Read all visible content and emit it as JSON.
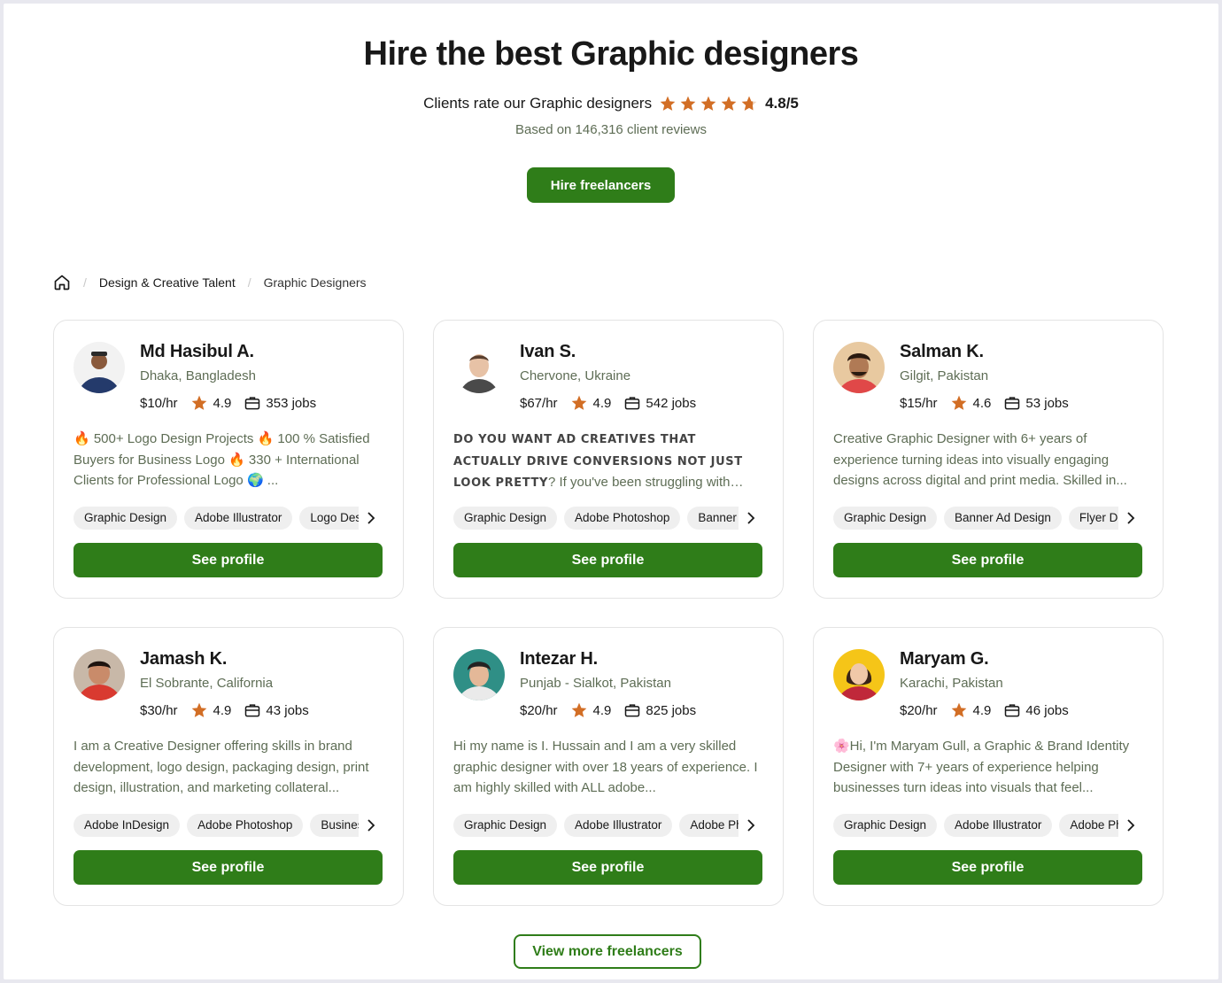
{
  "hero": {
    "title": "Hire the best Graphic designers",
    "rating_text": "Clients rate our Graphic designers",
    "rating_score": "4.8/5",
    "reviews": "Based on 146,316 client reviews",
    "hire_button": "Hire freelancers"
  },
  "breadcrumb": {
    "home_icon": "home-icon",
    "link": "Design & Creative Talent",
    "current": "Graphic Designers"
  },
  "colors": {
    "accent": "#2f7d19",
    "star": "#d26e25",
    "muted": "#5e6d55"
  },
  "freelancers": [
    {
      "name": "Md Hasibul A.",
      "location": "Dhaka, Bangladesh",
      "rate": "$10/hr",
      "score": "4.9",
      "jobs": "353 jobs",
      "description": "🔥 500+ Logo Design Projects 🔥 100 % Satisfied Buyers for Business Logo 🔥 330 + International Clients for Professional Logo 🌍 ...",
      "skills": [
        "Graphic Design",
        "Adobe Illustrator",
        "Logo Design"
      ],
      "button": "See profile"
    },
    {
      "name": "Ivan S.",
      "location": "Chervone, Ukraine",
      "rate": "$67/hr",
      "score": "4.9",
      "jobs": "542 jobs",
      "description_caps": "DO YOU WANT AD CREATIVES THAT ACTUALLY DRIVE CONVERSIONS NOT JUST LOOK PRETTY",
      "description": "? If you've been struggling with finding a designer...",
      "skills": [
        "Graphic Design",
        "Adobe Photoshop",
        "Banner Ad Design"
      ],
      "button": "See profile"
    },
    {
      "name": "Salman K.",
      "location": "Gilgit, Pakistan",
      "rate": "$15/hr",
      "score": "4.6",
      "jobs": "53 jobs",
      "description": "Creative Graphic Designer with 6+ years of experience turning ideas into visually engaging designs across digital and print media. Skilled in...",
      "skills": [
        "Graphic Design",
        "Banner Ad Design",
        "Flyer Design"
      ],
      "button": "See profile"
    },
    {
      "name": "Jamash K.",
      "location": "El Sobrante, California",
      "rate": "$30/hr",
      "score": "4.9",
      "jobs": "43 jobs",
      "description": "I am a Creative Designer offering skills in brand development, logo design, packaging design, print design, illustration, and marketing collateral...",
      "skills": [
        "Adobe InDesign",
        "Adobe Photoshop",
        "Business Card Design"
      ],
      "button": "See profile"
    },
    {
      "name": "Intezar H.",
      "location": "Punjab - Sialkot, Pakistan",
      "rate": "$20/hr",
      "score": "4.9",
      "jobs": "825 jobs",
      "description": "Hi my name is I. Hussain and I am a very skilled graphic designer with over 18 years of experience. I am highly skilled with ALL adobe...",
      "skills": [
        "Graphic Design",
        "Adobe Illustrator",
        "Adobe Photoshop"
      ],
      "button": "See profile"
    },
    {
      "name": "Maryam G.",
      "location": "Karachi, Pakistan",
      "rate": "$20/hr",
      "score": "4.9",
      "jobs": "46 jobs",
      "description": "🌸Hi, I'm Maryam Gull, a Graphic & Brand Identity Designer with 7+ years of experience helping businesses turn ideas into visuals that feel...",
      "skills": [
        "Graphic Design",
        "Adobe Illustrator",
        "Adobe Photoshop"
      ],
      "button": "See profile"
    }
  ],
  "footer": {
    "more_button": "View more freelancers"
  }
}
